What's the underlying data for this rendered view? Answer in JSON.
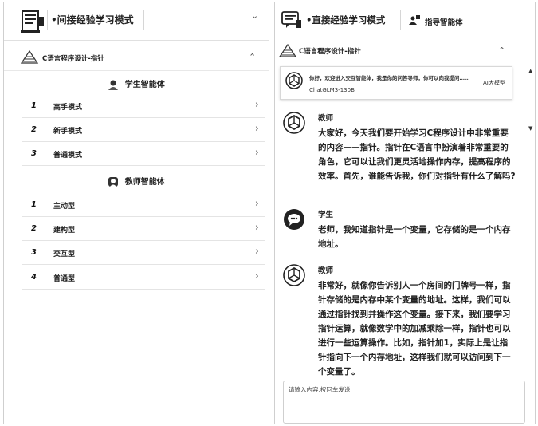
{
  "left_panel": {
    "mode_title": "•间接经验学习模式",
    "course_title": "C语言程序设计-指针",
    "student_agent": {
      "title": "学生智能体",
      "items": [
        {
          "num": "1",
          "label": "高手模式"
        },
        {
          "num": "2",
          "label": "新手模式"
        },
        {
          "num": "3",
          "label": "普通模式"
        }
      ]
    },
    "teacher_agent": {
      "title": "教师智能体",
      "items": [
        {
          "num": "1",
          "label": "主动型"
        },
        {
          "num": "2",
          "label": "建构型"
        },
        {
          "num": "3",
          "label": "交互型"
        },
        {
          "num": "4",
          "label": "普通型"
        }
      ]
    }
  },
  "right_panel": {
    "mode_title": "•直接经验学习模式",
    "guide_agent_label": "指导智能体",
    "course_title": "C语言程序设计-指针",
    "model_card": {
      "greeting": "你好，欢迎进入交互智能体，我是你的问答导师，你可以向我提问……",
      "model_name": "ChatGLM3-130B",
      "badge": "AI大模型"
    },
    "messages": [
      {
        "role": "教师",
        "text": "大家好，今天我们要开始学习C程序设计中非常重要的内容——指针。指针在C语言中扮演着非常重要的角色，它可以让我们更灵活地操作内存，提高程序的效率。首先，谁能告诉我，你们对指针有什么了解吗?"
      },
      {
        "role": "学生",
        "text": "老师，我知道指针是一个变量，它存储的是一个内存地址。"
      },
      {
        "role": "教师",
        "text": "非常好，就像你告诉别人一个房间的门牌号一样，指针存储的是内存中某个变量的地址。这样，我们可以通过指针找到并操作这个变量。接下来，我们要学习指针运算，就像数学中的加减乘除一样，指针也可以进行一些运算操作。比如，指针加1，实际上是让指针指向下一个内存地址，这样我们就可以访问到下一个变量了。"
      }
    ],
    "input_placeholder": "请输入内容,按回车发送"
  },
  "icons": {
    "chevron_down": "⌄",
    "chevron_up": "⌃",
    "chevron_right": "›",
    "scroll_up": "▲",
    "scroll_down": "▼"
  },
  "colors": {
    "border": "#cfcfcf",
    "text": "#222222"
  }
}
